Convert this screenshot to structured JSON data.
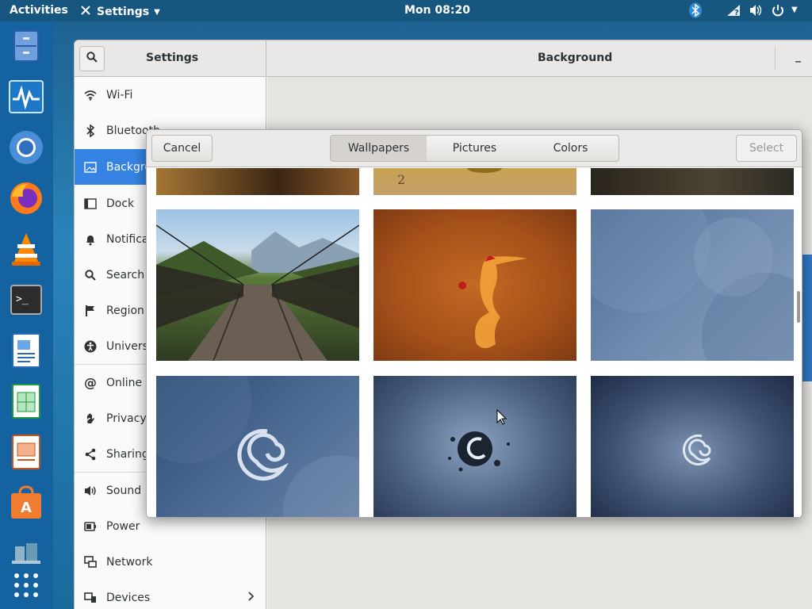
{
  "topbar": {
    "activities": "Activities",
    "app_menu": "Settings",
    "clock": "Mon 08:20"
  },
  "dock": {
    "items": [
      "file-cabinet",
      "system-monitor",
      "chromium",
      "firefox",
      "vlc",
      "terminal",
      "writer",
      "calc",
      "impress",
      "software-store",
      "network-tool",
      "app-grid"
    ]
  },
  "settings": {
    "title": "Settings",
    "panel_title": "Background",
    "sidebar": [
      {
        "label": "Wi-Fi",
        "icon": "wifi-icon"
      },
      {
        "label": "Bluetooth",
        "icon": "bluetooth-icon"
      },
      {
        "label": "Background",
        "icon": "background-icon",
        "selected": true
      },
      {
        "label": "Dock",
        "icon": "dock-icon"
      },
      {
        "label": "Notifications",
        "icon": "bell-icon"
      },
      {
        "label": "Search",
        "icon": "search-icon"
      },
      {
        "label": "Region & Language",
        "icon": "flag-icon"
      },
      {
        "label": "Universal Access",
        "icon": "accessibility-icon"
      },
      {
        "label": "Online Accounts",
        "icon": "at-icon"
      },
      {
        "label": "Privacy",
        "icon": "hand-icon"
      },
      {
        "label": "Sharing",
        "icon": "share-icon"
      },
      {
        "label": "Sound",
        "icon": "speaker-icon"
      },
      {
        "label": "Power",
        "icon": "power-icon"
      },
      {
        "label": "Network",
        "icon": "network-icon"
      },
      {
        "label": "Devices",
        "icon": "devices-icon"
      }
    ]
  },
  "dialog": {
    "cancel": "Cancel",
    "tabs": [
      {
        "label": "Wallpapers",
        "active": true
      },
      {
        "label": "Pictures"
      },
      {
        "label": "Colors"
      }
    ],
    "select": "Select",
    "wallpapers": [
      "warm-texture",
      "clock-sand",
      "dark-road",
      "suspension-bridge",
      "orange-bird",
      "blue-waves",
      "debian-swirl-blue",
      "debian-swirl-splash",
      "debian-swirl-small"
    ]
  },
  "colors": {
    "accent": "#3584e4",
    "topbar": "#17567f",
    "dock": "#1463a0"
  }
}
